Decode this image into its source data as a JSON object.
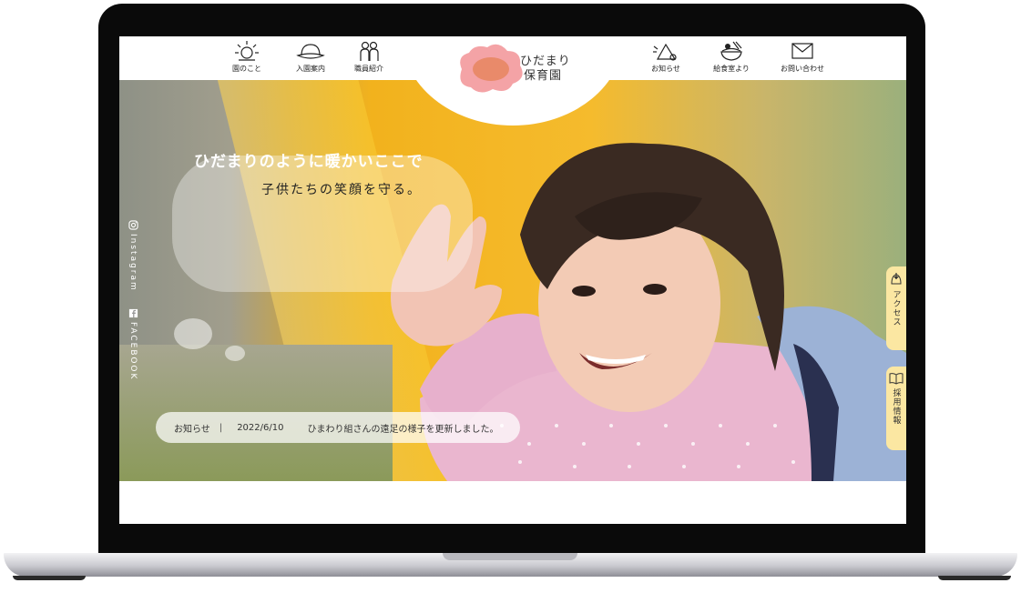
{
  "nav_left": [
    {
      "label": "園のこと",
      "icon": "sun-icon"
    },
    {
      "label": "入園案内",
      "icon": "hat-icon"
    },
    {
      "label": "職員紹介",
      "icon": "people-icon"
    }
  ],
  "nav_right": [
    {
      "label": "お知らせ",
      "icon": "megaphone-icon"
    },
    {
      "label": "給食室より",
      "icon": "rice-bowl-icon"
    },
    {
      "label": "お問い合わせ",
      "icon": "envelope-icon"
    }
  ],
  "logo": {
    "line1": "ひだまり",
    "line2": "保育園"
  },
  "hero": {
    "title": "ひだまりのように暖かいここで",
    "subtitle": "子供たちの笑顔を守る。"
  },
  "social": [
    {
      "label": "Instagram",
      "icon": "instagram-icon"
    },
    {
      "label": "FACEBOOK",
      "icon": "facebook-icon"
    }
  ],
  "news": {
    "label": "お知らせ",
    "separator": "|",
    "date": "2022/6/10",
    "text": "ひまわり組さんの遠足の様子を更新しました。"
  },
  "side_tabs": [
    {
      "label": "アクセス",
      "icon": "map-pin-icon"
    },
    {
      "label": "採用情報",
      "icon": "book-icon"
    }
  ],
  "colors": {
    "accent": "#fbe7a2",
    "logo_pink": "#f4a3a6",
    "logo_inner": "#e98a6a"
  }
}
